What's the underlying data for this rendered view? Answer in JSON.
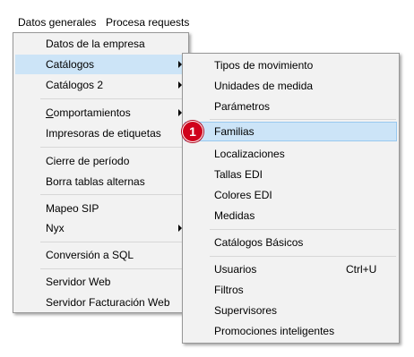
{
  "menubar": {
    "items": [
      {
        "label": "Datos generales"
      },
      {
        "label": "Procesa requests"
      }
    ]
  },
  "main_menu": {
    "items": [
      {
        "label": "Datos de la empresa",
        "has_submenu": false
      },
      {
        "label": "Catálogos",
        "has_submenu": true,
        "selected": true
      },
      {
        "label": "Catálogos 2",
        "has_submenu": true
      },
      {
        "label_first": "C",
        "label_rest": "omportamientos",
        "has_submenu": true
      },
      {
        "label": "Impresoras de etiquetas",
        "has_submenu": false
      },
      {
        "label": "Cierre de período",
        "has_submenu": false
      },
      {
        "label": "Borra tablas alternas",
        "has_submenu": false
      },
      {
        "label": "Mapeo SIP",
        "has_submenu": false
      },
      {
        "label": "Nyx",
        "has_submenu": true
      },
      {
        "label": "Conversión a SQL",
        "has_submenu": false
      },
      {
        "label": "Servidor Web",
        "has_submenu": false
      },
      {
        "label": "Servidor Facturación Web",
        "has_submenu": false
      }
    ]
  },
  "submenu": {
    "items": [
      {
        "label": "Tipos de movimiento"
      },
      {
        "label": "Unidades de medida"
      },
      {
        "label": "Parámetros"
      },
      {
        "label": "Familias",
        "highlighted": true
      },
      {
        "label": "Localizaciones"
      },
      {
        "label": "Tallas EDI"
      },
      {
        "label": "Colores EDI"
      },
      {
        "label": "Medidas"
      },
      {
        "label": "Catálogos Básicos"
      },
      {
        "label": "Usuarios",
        "shortcut": "Ctrl+U"
      },
      {
        "label": "Filtros"
      },
      {
        "label": "Supervisores"
      },
      {
        "label": "Promociones inteligentes"
      }
    ]
  },
  "annotation": {
    "badge_number": "1"
  },
  "colors": {
    "menu_bg": "#f2f2f2",
    "highlight_bg": "#cce4f7",
    "highlight_border": "#99c9ef",
    "badge_red": "#d0021b"
  }
}
